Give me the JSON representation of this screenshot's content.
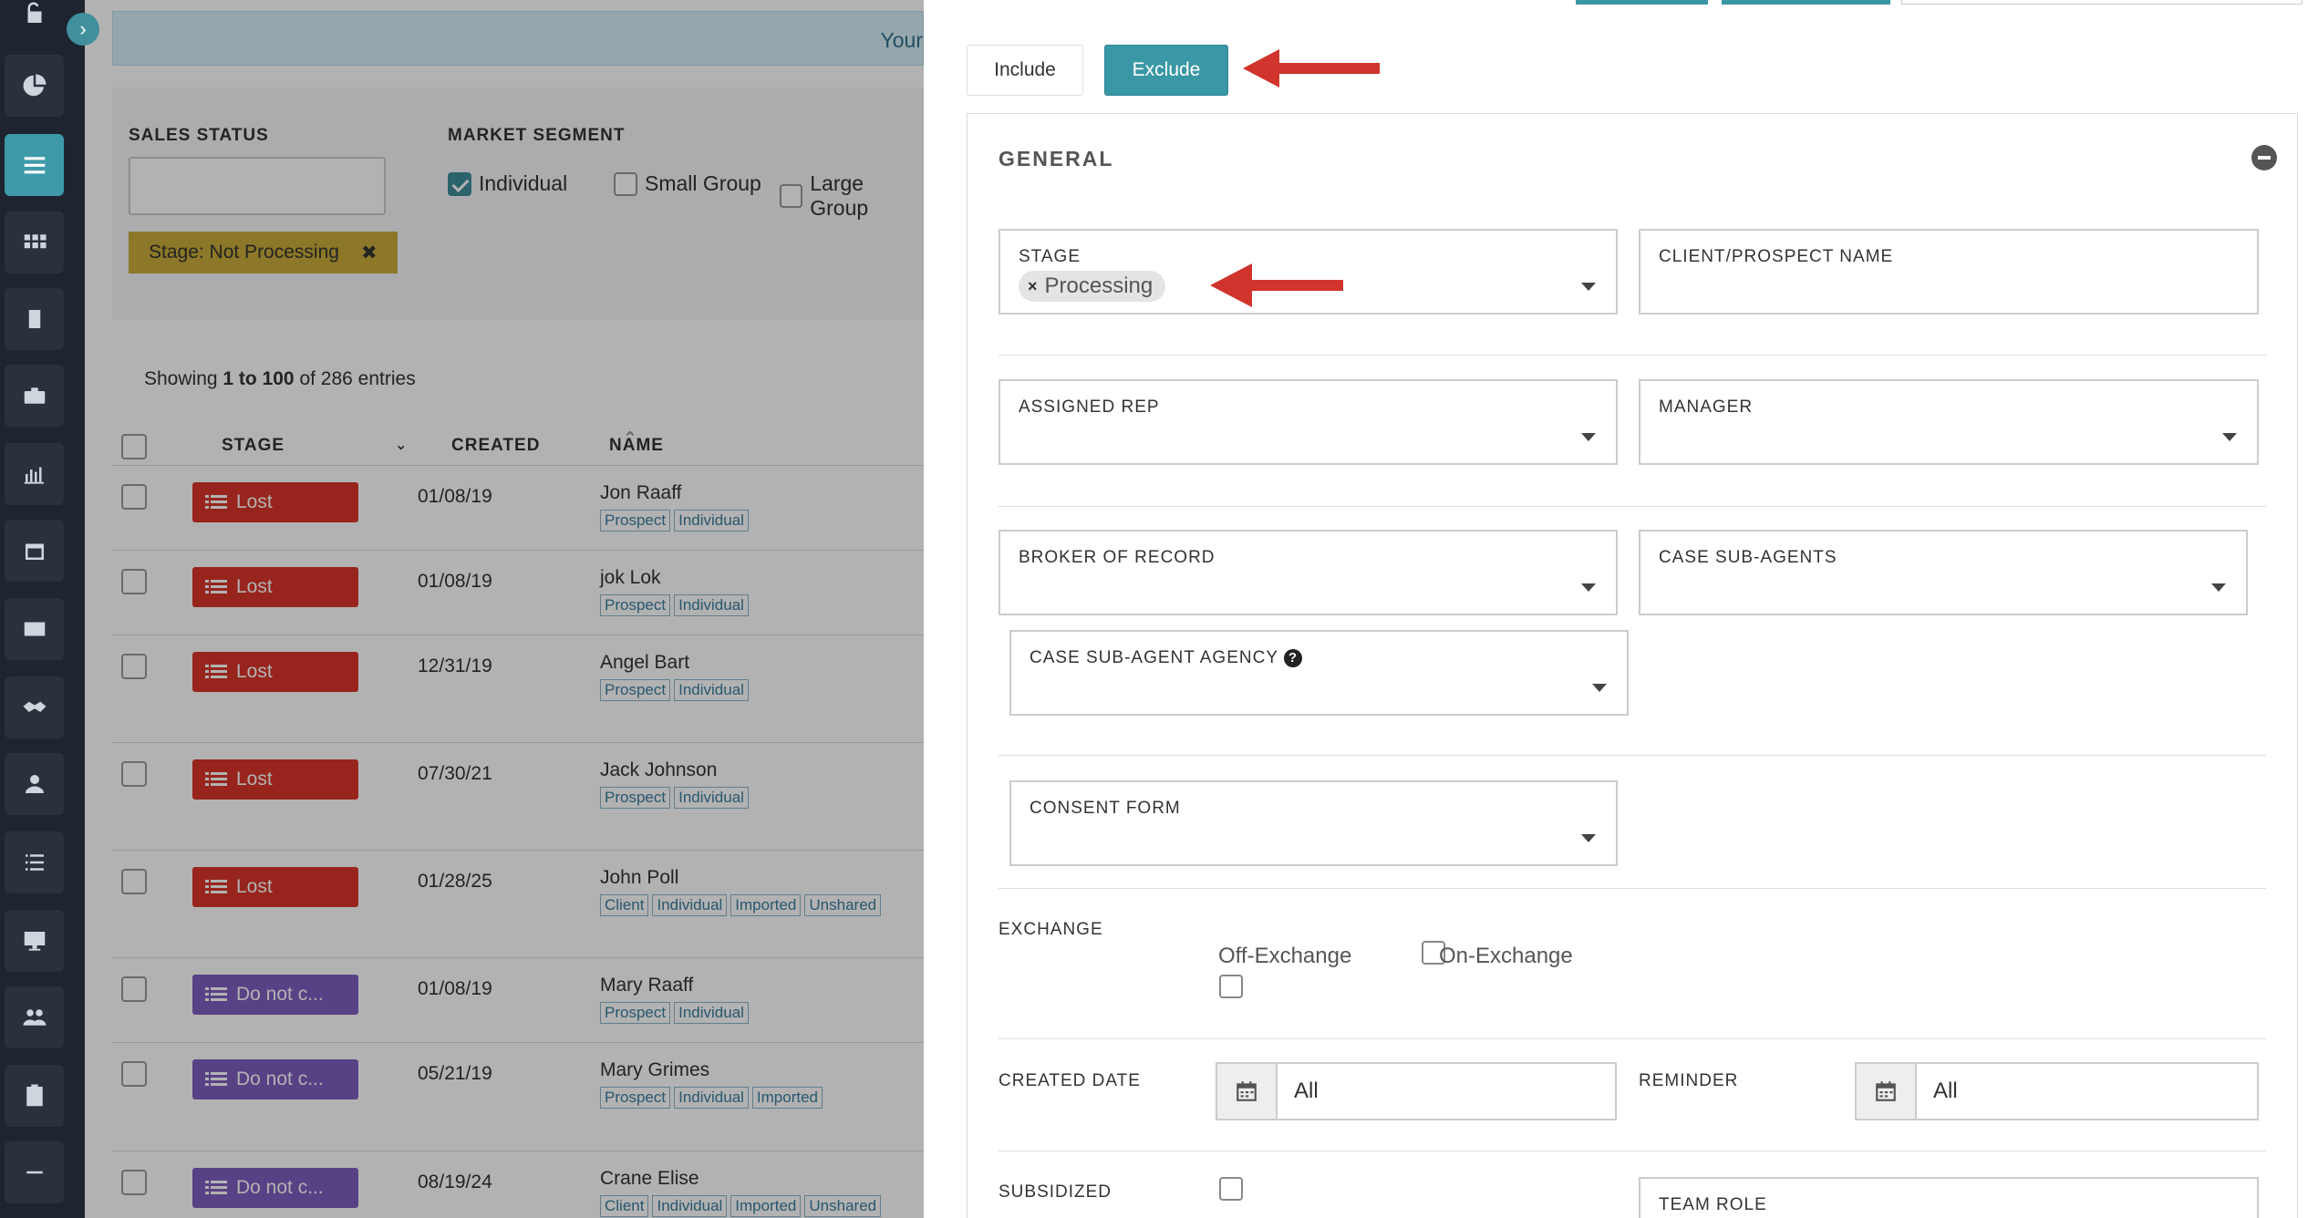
{
  "banner": {
    "text": "Your"
  },
  "filters": {
    "sales_status_label": "SALES STATUS",
    "market_segment_label": "MARKET SEGMENT",
    "segments": [
      {
        "label": "Individual",
        "checked": true
      },
      {
        "label": "Small Group",
        "checked": false
      },
      {
        "label": "Large Group",
        "checked": false
      }
    ],
    "active_chip": "Stage: Not Processing",
    "chip_close": "✖"
  },
  "table": {
    "showing_prefix": "Showing ",
    "showing_range": "1 to 100",
    "showing_suffix": " of 286 entries",
    "headers": {
      "stage": "STAGE",
      "created": "CREATED",
      "name": "NAME"
    },
    "rows": [
      {
        "stage": "Lost",
        "kind": "lost",
        "created": "01/08/19",
        "name": "Jon Raaff",
        "tags": [
          "Prospect",
          "Individual"
        ]
      },
      {
        "stage": "Lost",
        "kind": "lost",
        "created": "01/08/19",
        "name": "jok Lok",
        "tags": [
          "Prospect",
          "Individual"
        ]
      },
      {
        "stage": "Lost",
        "kind": "lost",
        "created": "12/31/19",
        "name": "Angel Bart",
        "tags": [
          "Prospect",
          "Individual"
        ]
      },
      {
        "stage": "Lost",
        "kind": "lost",
        "created": "07/30/21",
        "name": "Jack Johnson",
        "tags": [
          "Prospect",
          "Individual"
        ]
      },
      {
        "stage": "Lost",
        "kind": "lost",
        "created": "01/28/25",
        "name": "John Poll",
        "tags": [
          "Client",
          "Individual",
          "Imported",
          "Unshared"
        ]
      },
      {
        "stage": "Do not c...",
        "kind": "dnc",
        "created": "01/08/19",
        "name": "Mary Raaff",
        "tags": [
          "Prospect",
          "Individual"
        ]
      },
      {
        "stage": "Do not c...",
        "kind": "dnc",
        "created": "05/21/19",
        "name": "Mary Grimes",
        "tags": [
          "Prospect",
          "Individual",
          "Imported"
        ]
      },
      {
        "stage": "Do not c...",
        "kind": "dnc",
        "created": "08/19/24",
        "name": "Crane Elise",
        "tags": [
          "Client",
          "Individual",
          "Imported",
          "Unshared"
        ]
      }
    ]
  },
  "panel": {
    "include_label": "Include",
    "exclude_label": "Exclude",
    "section_title": "GENERAL",
    "stage_label": "STAGE",
    "stage_value": "Processing",
    "client_name_label": "CLIENT/PROSPECT NAME",
    "assigned_rep_label": "ASSIGNED REP",
    "manager_label": "MANAGER",
    "broker_label": "BROKER OF RECORD",
    "case_sub_agents_label": "CASE SUB-AGENTS",
    "case_sub_agent_agency_label": "CASE SUB-AGENT AGENCY",
    "consent_form_label": "CONSENT FORM",
    "exchange_label": "EXCHANGE",
    "off_exchange_label": "Off-Exchange",
    "on_exchange_label": "On-Exchange",
    "created_date_label": "CREATED DATE",
    "created_date_value": "All",
    "reminder_label": "REMINDER",
    "reminder_value": "All",
    "subsidized_label": "SUBSIDIZED",
    "team_role_label": "TEAM ROLE"
  },
  "colors": {
    "accent": "#3a97a6",
    "lost": "#d9352a",
    "dnc": "#7f5fc0",
    "chip": "#c9ac3a",
    "annotation_arrow": "#d0342c"
  }
}
